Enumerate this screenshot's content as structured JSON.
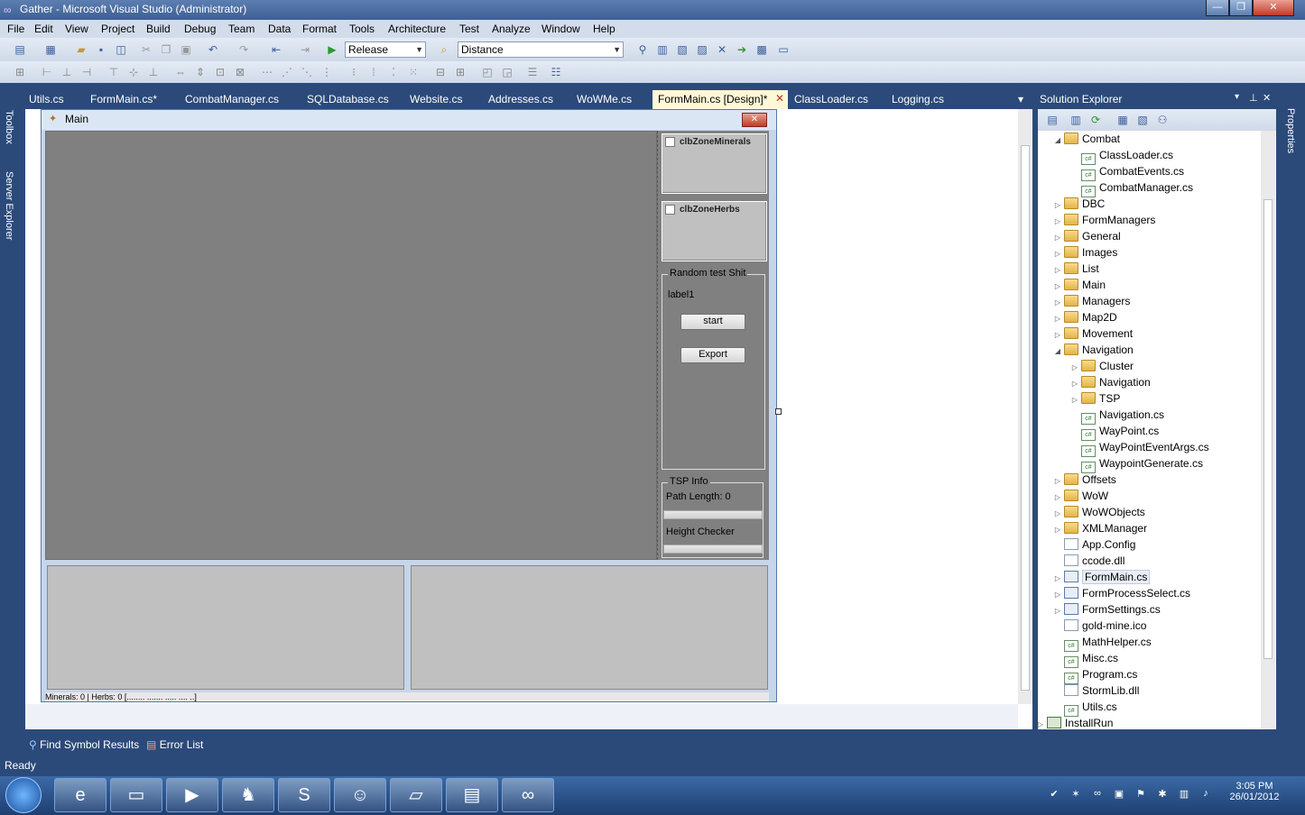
{
  "window": {
    "title": "Gather - Microsoft Visual Studio (Administrator)",
    "min_glyph": "—",
    "max_glyph": "❐",
    "close_glyph": "✕"
  },
  "menu": [
    "File",
    "Edit",
    "View",
    "Project",
    "Build",
    "Debug",
    "Team",
    "Data",
    "Format",
    "Tools",
    "Architecture",
    "Test",
    "Analyze",
    "Window",
    "Help"
  ],
  "toolbar": {
    "config_value": "Release",
    "find_value": "Distance"
  },
  "tabs": [
    {
      "label": "Utils.cs"
    },
    {
      "label": "FormMain.cs*"
    },
    {
      "label": "CombatManager.cs"
    },
    {
      "label": "SQLDatabase.cs"
    },
    {
      "label": "Website.cs"
    },
    {
      "label": "Addresses.cs"
    },
    {
      "label": "WoWMe.cs"
    },
    {
      "label": "FormMain.cs [Design]*",
      "active": true
    },
    {
      "label": "ClassLoader.cs"
    },
    {
      "label": "Logging.cs"
    }
  ],
  "side_rail": {
    "toolbox": "Toolbox",
    "server_explorer": "Server Explorer",
    "properties": "Properties"
  },
  "designer": {
    "form_title": "Main",
    "clb_minerals": "clbZoneMinerals",
    "clb_herbs": "clbZoneHerbs",
    "group_random": "Random test Shit",
    "label1": "label1",
    "start_button": "start",
    "export_button": "Export",
    "group_tsp": "TSP Info",
    "path_length": "Path Length:  0",
    "height_checker": "Height Checker",
    "status_strip": "Minerals: 0  |  Herbs: 0  [........ ....... ..... .... ..]"
  },
  "solution_explorer": {
    "title": "Solution Explorer",
    "nodes": [
      {
        "label": "Combat",
        "type": "folder",
        "expanded": true
      },
      {
        "label": "ClassLoader.cs",
        "type": "cs"
      },
      {
        "label": "CombatEvents.cs",
        "type": "cs"
      },
      {
        "label": "CombatManager.cs",
        "type": "cs"
      },
      {
        "label": "DBC",
        "type": "folder"
      },
      {
        "label": "FormManagers",
        "type": "folder"
      },
      {
        "label": "General",
        "type": "folder"
      },
      {
        "label": "Images",
        "type": "folder"
      },
      {
        "label": "List",
        "type": "folder"
      },
      {
        "label": "Main",
        "type": "folder"
      },
      {
        "label": "Managers",
        "type": "folder"
      },
      {
        "label": "Map2D",
        "type": "folder"
      },
      {
        "label": "Movement",
        "type": "folder"
      },
      {
        "label": "Navigation",
        "type": "folder",
        "expanded": true
      },
      {
        "label": "Cluster",
        "type": "folder"
      },
      {
        "label": "Navigation",
        "type": "folder"
      },
      {
        "label": "TSP",
        "type": "folder"
      },
      {
        "label": "Navigation.cs",
        "type": "cs"
      },
      {
        "label": "WayPoint.cs",
        "type": "cs"
      },
      {
        "label": "WayPointEventArgs.cs",
        "type": "cs"
      },
      {
        "label": "WaypointGenerate.cs",
        "type": "cs"
      },
      {
        "label": "Offsets",
        "type": "folder"
      },
      {
        "label": "WoW",
        "type": "folder"
      },
      {
        "label": "WoWObjects",
        "type": "folder"
      },
      {
        "label": "XMLManager",
        "type": "folder"
      },
      {
        "label": "App.Config",
        "type": "file"
      },
      {
        "label": "ccode.dll",
        "type": "file"
      },
      {
        "label": "FormMain.cs",
        "type": "form"
      },
      {
        "label": "FormProcessSelect.cs",
        "type": "form"
      },
      {
        "label": "FormSettings.cs",
        "type": "form"
      },
      {
        "label": "gold-mine.ico",
        "type": "file"
      },
      {
        "label": "MathHelper.cs",
        "type": "cs"
      },
      {
        "label": "Misc.cs",
        "type": "cs"
      },
      {
        "label": "Program.cs",
        "type": "cs"
      },
      {
        "label": "StormLib.dll",
        "type": "file"
      },
      {
        "label": "Utils.cs",
        "type": "cs"
      },
      {
        "label": "InstallRun",
        "type": "project"
      }
    ]
  },
  "bottom_tabs": {
    "find_symbol": "Find Symbol Results",
    "error_list": "Error List"
  },
  "status": "Ready",
  "clock": {
    "time": "3:05 PM",
    "date": "26/01/2012"
  }
}
